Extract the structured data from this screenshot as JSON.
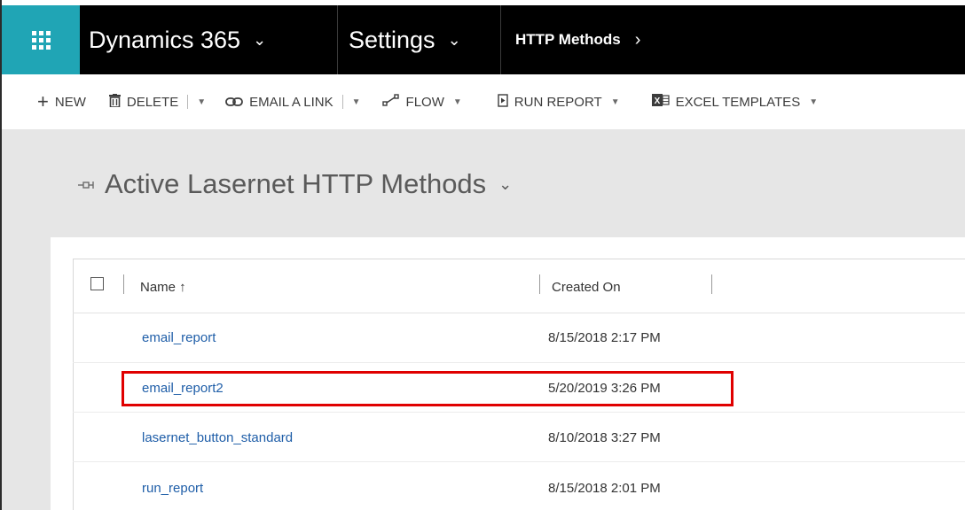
{
  "nav": {
    "app_name": "Dynamics 365",
    "area": "Settings",
    "entity": "HTTP Methods",
    "app_chevron": "⌄",
    "area_chevron": "⌄",
    "entity_chevron": "›"
  },
  "toolbar": {
    "new_label": "NEW",
    "delete_label": "DELETE",
    "email_link_label": "EMAIL A LINK",
    "flow_label": "FLOW",
    "run_report_label": "RUN REPORT",
    "excel_templates_label": "EXCEL TEMPLATES"
  },
  "icons": {
    "waffle": "waffle-icon",
    "new": "plus-icon",
    "delete": "trash-icon",
    "email_link": "link-icon",
    "flow": "flow-icon",
    "run_report": "report-icon",
    "excel": "excel-icon",
    "pin": "pin-icon"
  },
  "view": {
    "title": "Active Lasernet HTTP Methods"
  },
  "grid": {
    "columns": {
      "name": "Name ↑",
      "created_on": "Created On"
    },
    "rows": [
      {
        "name": "email_report",
        "created_on": "8/15/2018 2:17 PM"
      },
      {
        "name": "email_report2",
        "created_on": "5/20/2019 3:26 PM"
      },
      {
        "name": "lasernet_button_standard",
        "created_on": "8/10/2018 3:27 PM"
      },
      {
        "name": "run_report",
        "created_on": "8/15/2018 2:01 PM"
      }
    ]
  },
  "colors": {
    "waffle_bg": "#20a5b5",
    "navbar_bg": "#000000",
    "link": "#1f5ea8",
    "highlight": "#e00000",
    "workarea_bg": "#e6e6e6"
  }
}
